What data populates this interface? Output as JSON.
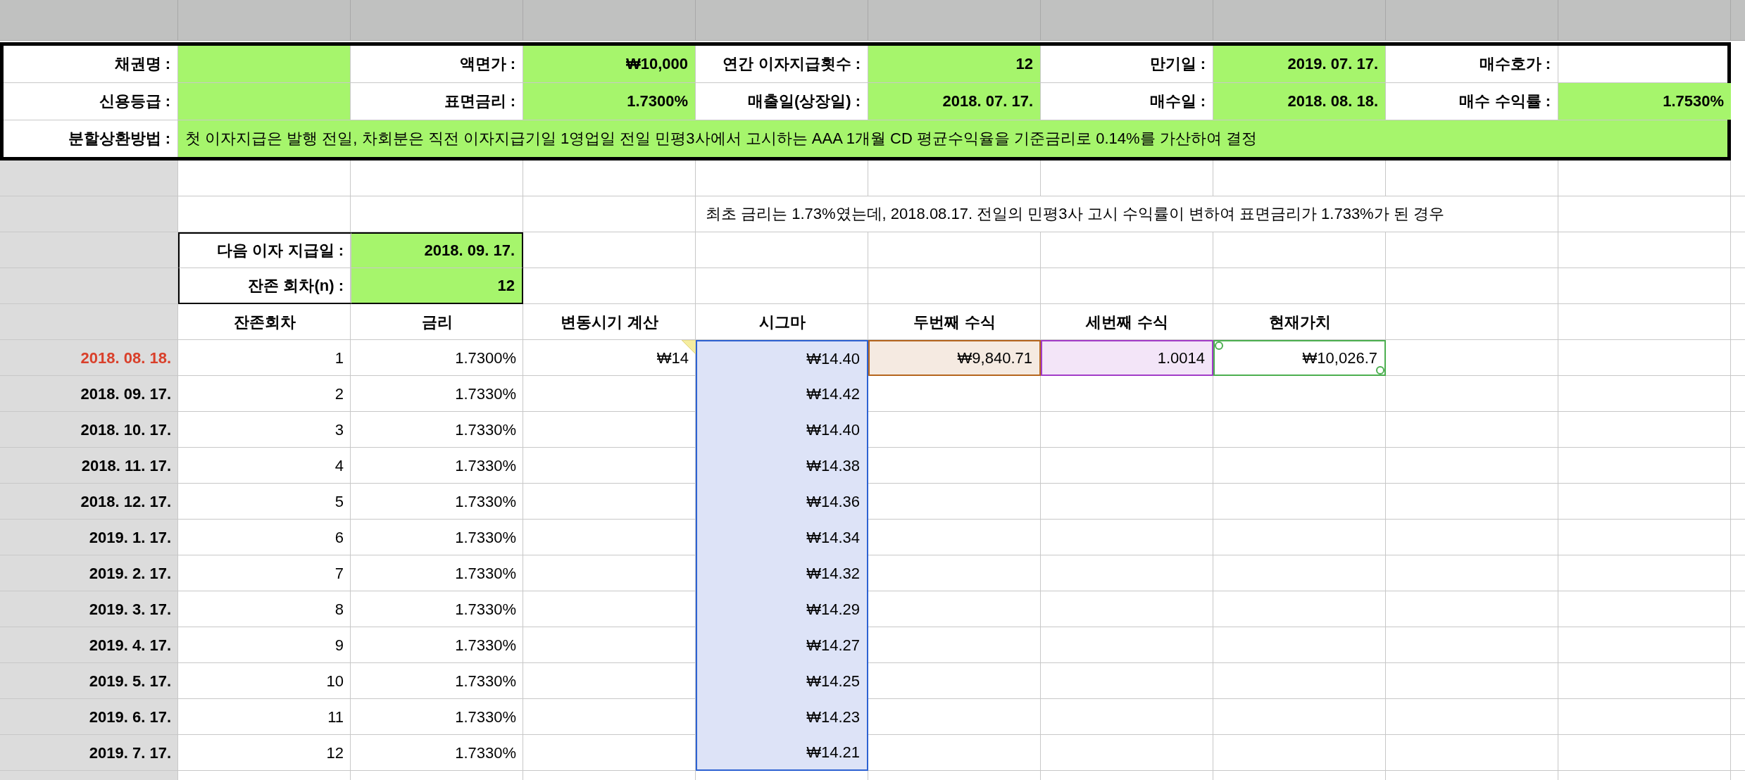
{
  "info": {
    "rows": [
      [
        {
          "label": "채권명 :",
          "highlighted": true
        },
        {
          "label": "액면가 :",
          "value": "₩10,000",
          "highlighted": true
        },
        {
          "label": "연간 이자지급횟수 :",
          "value": "12",
          "highlighted": true
        },
        {
          "label": "만기일 :",
          "value": "2019. 07. 17.",
          "highlighted": true
        },
        {
          "label": "매수호가 :"
        }
      ],
      [
        {
          "label": "신용등급 :",
          "highlighted": true
        },
        {
          "label": "표면금리 :",
          "value": "1.7300%",
          "highlighted": true
        },
        {
          "label": "매출일(상장일) :",
          "value": "2018. 07. 17.",
          "highlighted": true
        },
        {
          "label": "매수일 :",
          "value": "2018. 08. 18.",
          "highlighted": true
        },
        {
          "label": "매수 수익률 :",
          "value": "1.7530%",
          "highlighted": true
        }
      ]
    ],
    "method": {
      "label": "분할상환방법 :",
      "value": "첫 이자지급은 발행 전일, 차회분은 직전 이자지급기일 1영업일 전일 민평3사에서 고시하는 AAA 1개월 CD 평균수익율을 기준금리로 0.14%를 가산하여 결정",
      "highlighted": true
    }
  },
  "note": "최초 금리는 1.73%였는데, 2018.08.17. 전일의 민평3사 고시 수익률이 변하여 표면금리가 1.733%가 된 경우",
  "next_payment": [
    {
      "label": "다음 이자 지급일 :",
      "value": "2018. 09. 17.",
      "highlighted": true
    },
    {
      "label": "잔존 회차(n) :",
      "value": "12",
      "highlighted": true
    }
  ],
  "table": {
    "columns": [
      "잔존회차",
      "금리",
      "변동시기 계산",
      "시그마",
      "두번째 수식",
      "세번째 수식",
      "현재가치"
    ],
    "rows": [
      {
        "date": "2018. 08. 18.",
        "color": "#d9402b",
        "n": "1",
        "rate": "1.7300%",
        "calc": "₩14",
        "comment": true,
        "sigma": "₩14.40",
        "sigma_selected": true,
        "refs": [
          {
            "text": "₩9,840.71",
            "color": "#b5651d",
            "kind": "reference"
          },
          {
            "text": "1.0014",
            "color": "#a23cc8",
            "kind": "reference"
          },
          {
            "text": "₩10,026.7",
            "color": "#4caf50",
            "kind": "editing"
          }
        ]
      },
      {
        "date": "2018. 09. 17.",
        "color": "#000000",
        "n": "2",
        "rate": "1.7330%",
        "sigma": "₩14.42",
        "sigma_selected": true
      },
      {
        "date": "2018. 10. 17.",
        "color": "#000000",
        "n": "3",
        "rate": "1.7330%",
        "sigma": "₩14.40",
        "sigma_selected": true
      },
      {
        "date": "2018. 11. 17.",
        "color": "#000000",
        "n": "4",
        "rate": "1.7330%",
        "sigma": "₩14.38",
        "sigma_selected": true
      },
      {
        "date": "2018. 12. 17.",
        "color": "#000000",
        "n": "5",
        "rate": "1.7330%",
        "sigma": "₩14.36",
        "sigma_selected": true
      },
      {
        "date": "2019. 1. 17.",
        "color": "#000000",
        "n": "6",
        "rate": "1.7330%",
        "sigma": "₩14.34",
        "sigma_selected": true
      },
      {
        "date": "2019. 2. 17.",
        "color": "#000000",
        "n": "7",
        "rate": "1.7330%",
        "sigma": "₩14.32",
        "sigma_selected": true
      },
      {
        "date": "2019. 3. 17.",
        "color": "#000000",
        "n": "8",
        "rate": "1.7330%",
        "sigma": "₩14.29",
        "sigma_selected": true
      },
      {
        "date": "2019. 4. 17.",
        "color": "#000000",
        "n": "9",
        "rate": "1.7330%",
        "sigma": "₩14.27",
        "sigma_selected": true
      },
      {
        "date": "2019. 5. 17.",
        "color": "#000000",
        "n": "10",
        "rate": "1.7330%",
        "sigma": "₩14.25",
        "sigma_selected": true
      },
      {
        "date": "2019. 6. 17.",
        "color": "#000000",
        "n": "11",
        "rate": "1.7330%",
        "sigma": "₩14.23",
        "sigma_selected": true
      },
      {
        "date": "2019. 7. 17.",
        "color": "#000000",
        "n": "12",
        "rate": "1.7330%",
        "sigma": "₩14.21",
        "sigma_selected": true
      }
    ]
  }
}
